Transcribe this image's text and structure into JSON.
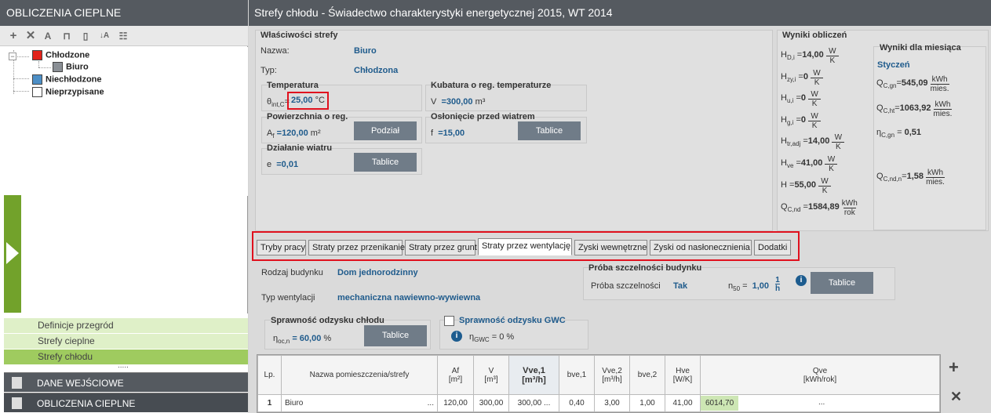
{
  "left": {
    "title": "OBLICZENIA CIEPLNE",
    "tree": {
      "chlodzone": "Chłodzone",
      "biuro": "Biuro",
      "niechlodzone": "Niechłodzone",
      "nieprzypisane": "Nieprzypisane"
    },
    "nav": [
      "Definicje przegród",
      "Strefy cieplne",
      "Strefy chłodu"
    ],
    "dots": ".....",
    "dane": "DANE WEJŚCIOWE",
    "obliczenia": "OBLICZENIA CIEPLNE"
  },
  "header": {
    "title": "Strefy chłodu - Świadectwo charakterystyki energetycznej 2015, WT 2014"
  },
  "props": {
    "title": "Właściwości strefy",
    "nazwa_label": "Nazwa:",
    "nazwa": "Biuro",
    "typ_label": "Typ:",
    "typ": "Chłodzona",
    "temp_title": "Temperatura",
    "temp_sym": "θ",
    "temp_sub": "int,C",
    "temp_value": "25,00",
    "temp_unit": "°C",
    "kub_title": "Kubatura o reg. temperaturze",
    "kub_sym": "V",
    "kub_value": "=300,00",
    "kub_unit": "m³",
    "pow_title": "Powierzchnia o reg.",
    "pow_sym": "A",
    "pow_sub": "f",
    "pow_value": "=120,00",
    "pow_unit": "m²",
    "podzial": "Podział",
    "osl_title": "Osłonięcie przed wiatrem",
    "osl_sym": "f",
    "osl_value": "=15,00",
    "tablice": "Tablice",
    "dzial_title": "Działanie wiatru",
    "dzial_sym": "e",
    "dzial_value": "=0,01"
  },
  "results": {
    "title": "Wyniki obliczeń",
    "rows": [
      {
        "sym": "H",
        "sub": "D,i",
        "val": "14,00",
        "num": "W",
        "den": "K"
      },
      {
        "sym": "H",
        "sub": "zy,i",
        "val": "0",
        "num": "W",
        "den": "K"
      },
      {
        "sym": "H",
        "sub": "u,i",
        "val": "0",
        "num": "W",
        "den": "K"
      },
      {
        "sym": "H",
        "sub": "g,i",
        "val": "0",
        "num": "W",
        "den": "K"
      },
      {
        "sym": "H",
        "sub": "tr,adj",
        "val": "14,00",
        "num": "W",
        "den": "K"
      },
      {
        "sym": "H",
        "sub": "ve",
        "val": "41,00",
        "num": "W",
        "den": "K"
      },
      {
        "sym": "H",
        "sub": "",
        "val": "55,00",
        "num": "W",
        "den": "K"
      },
      {
        "sym": "Q",
        "sub": "C,nd",
        "val": "1584,89",
        "num": "kWh",
        "den": "rok"
      }
    ]
  },
  "month": {
    "title": "Wyniki dla miesiąca",
    "name": "Styczeń",
    "qcgn": {
      "sym": "Q",
      "sub": "C,gn",
      "val": "545,09",
      "num": "kWh",
      "den": "mies."
    },
    "qcht": {
      "sym": "Q",
      "sub": "C,ht",
      "val": "1063,92",
      "num": "kWh",
      "den": "mies."
    },
    "eta": {
      "sym": "η",
      "sub": "C,gn",
      "val": "0,51"
    },
    "qcnd": {
      "sym": "Q",
      "sub": "C,nd,n",
      "val": "1,58",
      "num": "kWh",
      "den": "mies."
    }
  },
  "tabs": [
    "Tryby pracy",
    "Straty przez przenikanie",
    "Straty przez grunt",
    "Straty przez wentylację",
    "Zyski wewnętrzne",
    "Zyski od nasłonecznienia",
    "Dodatki"
  ],
  "vent": {
    "rodzaj_label": "Rodzaj budynku",
    "rodzaj": "Dom jednorodzinny",
    "typ_label": "Typ wentylacji",
    "typ": "mechaniczna nawiewno-wywiewna",
    "proba_title": "Próba szczelności budynku",
    "proba_label": "Próba szczelności",
    "proba": "Tak",
    "n50_sym": "n",
    "n50_sub": "50",
    "n50_val": "1,00",
    "n50_num": "1",
    "n50_den": "h",
    "spr_title": "Sprawność odzysku chłodu",
    "spr_sym": "η",
    "spr_sub": "oc,n",
    "spr_val": "= 60,00",
    "spr_unit": "%",
    "gwc_title": "Sprawność odzysku GWC",
    "gwc_sym": "η",
    "gwc_sub": "GWC",
    "gwc_val": "= 0",
    "gwc_unit": "%",
    "tablice": "Tablice"
  },
  "table": {
    "headers": [
      [
        "Lp.",
        ""
      ],
      [
        "Nazwa pomieszczenia/strefy",
        ""
      ],
      [
        "Af",
        "[m²]"
      ],
      [
        "V",
        "[m³]"
      ],
      [
        "Vve,1",
        "[m³/h]"
      ],
      [
        "bve,1",
        ""
      ],
      [
        "Vve,2",
        "[m³/h]"
      ],
      [
        "bve,2",
        ""
      ],
      [
        "Hve",
        "[W/K]"
      ],
      [
        "Qve",
        "[kWh/rok]"
      ]
    ],
    "row": {
      "lp": "1",
      "name": "Biuro",
      "ellipsis": "...",
      "af": "120,00",
      "v": "300,00",
      "vve1": "300,00",
      "bve1": "0,40",
      "vve2": "3,00",
      "bve2": "1,00",
      "hve": "41,00",
      "qve": "6014,70"
    }
  }
}
